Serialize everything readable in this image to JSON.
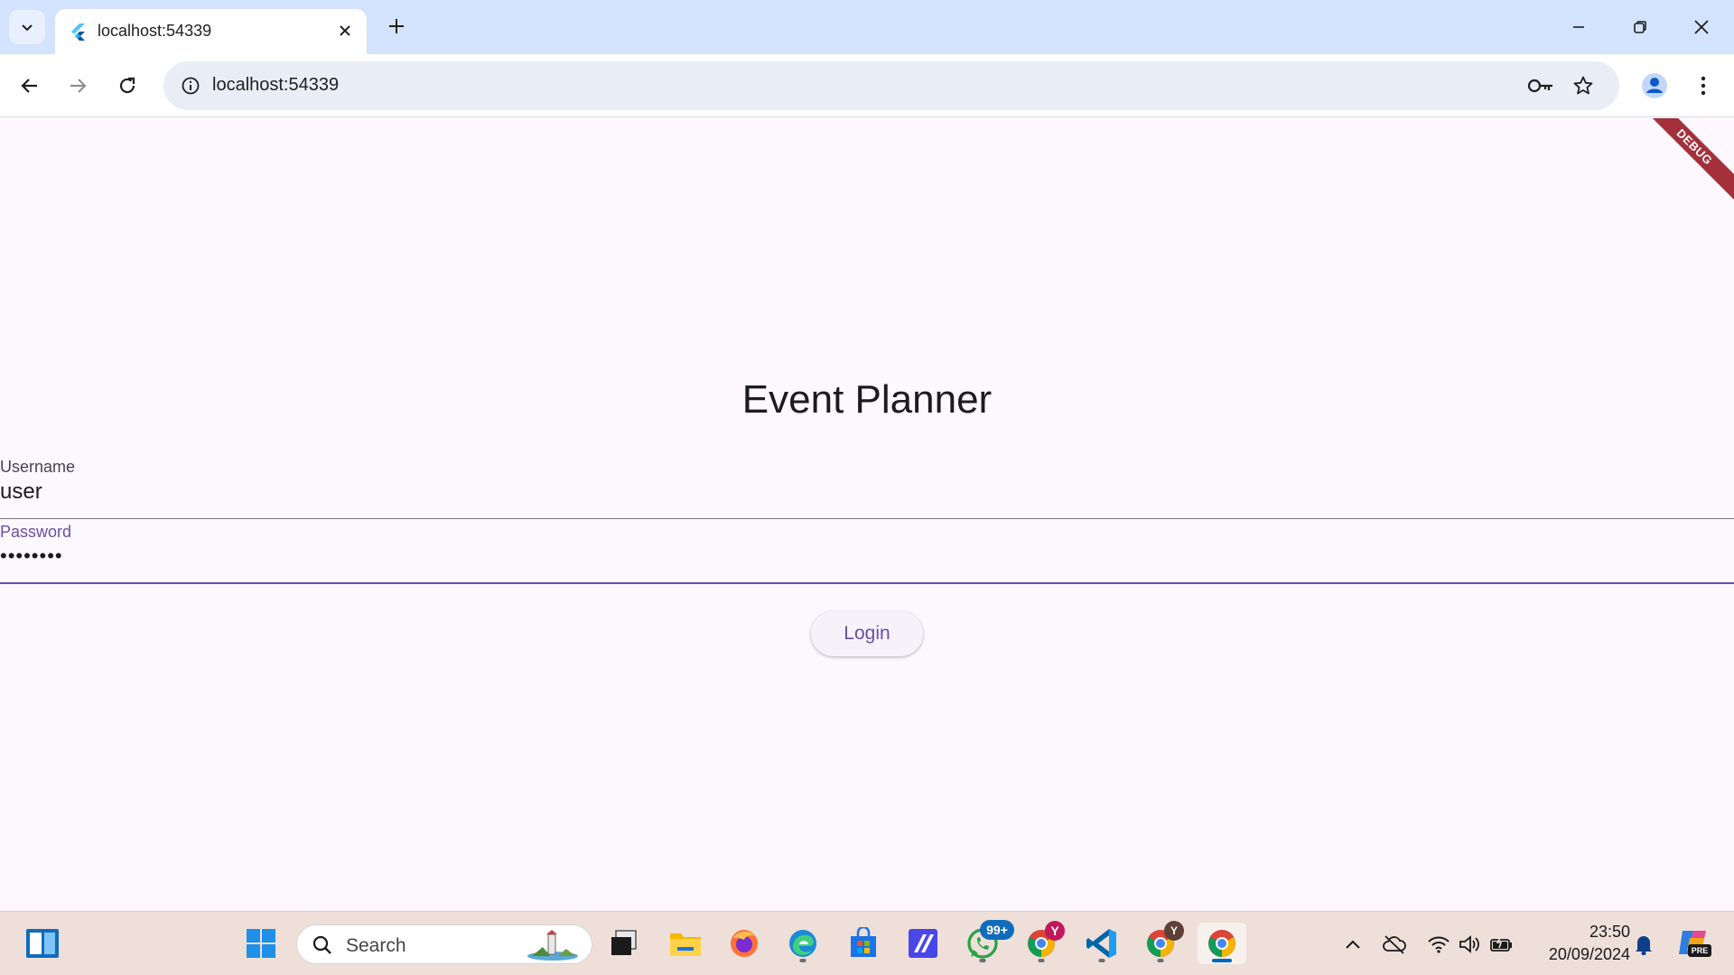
{
  "browser": {
    "tab_title": "localhost:54339",
    "url": "localhost:54339"
  },
  "page": {
    "debug_banner": "DEBUG",
    "title": "Event Planner",
    "username_label": "Username",
    "username_value": "user",
    "password_label": "Password",
    "password_value": "••••••••",
    "login_label": "Login"
  },
  "taskbar": {
    "search_placeholder": "Search",
    "whatsapp_badge": "99+",
    "chrome_profile_badge_1": "Y",
    "chrome_profile_badge_2": "Y",
    "clock_time": "23:50",
    "clock_date": "20/09/2024",
    "copilot_badge": "PRE"
  },
  "colors": {
    "accent": "#6750a4",
    "page_background": "#fdf7fe",
    "debug_banner": "#a3303a"
  }
}
